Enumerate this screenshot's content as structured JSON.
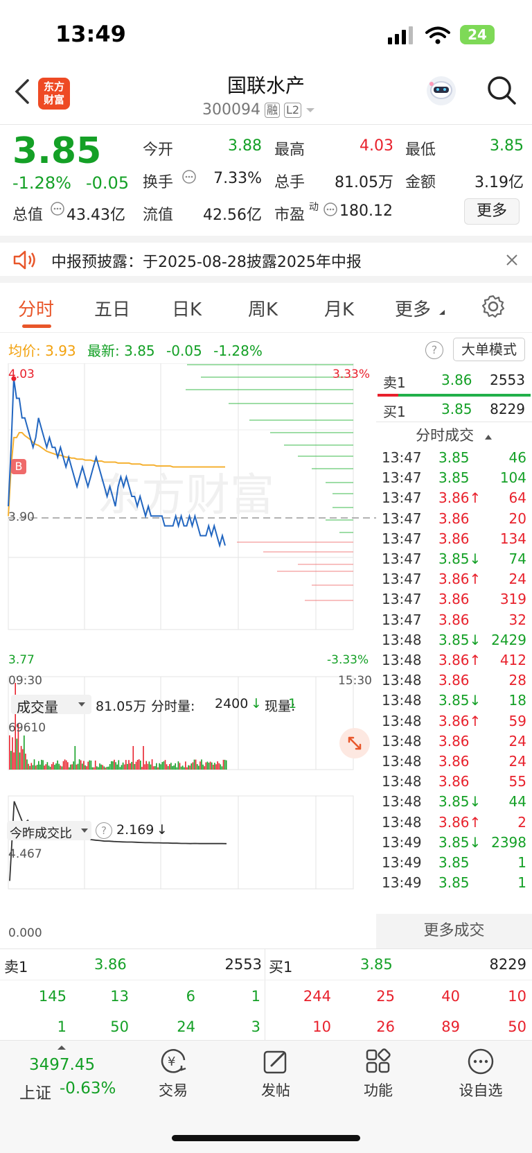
{
  "status": {
    "time": "13:49",
    "battery": "24"
  },
  "header": {
    "logo_text": "东方\n财富",
    "stock_name": "国联水产",
    "stock_code": "300094",
    "tag_rong": "融",
    "tag_l2": "L2"
  },
  "quote": {
    "price": "3.85",
    "pct": "-1.28%",
    "change": "-0.05",
    "open_label": "今开",
    "open": "3.88",
    "high_label": "最高",
    "high": "4.03",
    "low_label": "最低",
    "low": "3.85",
    "turnover_label": "换手",
    "turnover": "7.33%",
    "volume_label": "总手",
    "volume": "81.05万",
    "amount_label": "金额",
    "amount": "3.19亿",
    "mcap_label": "总值",
    "mcap": "43.43亿",
    "float_label": "流值",
    "float": "42.56亿",
    "pe_label": "市盈",
    "pe_sup": "动",
    "pe": "180.12",
    "more": "更多"
  },
  "notice": {
    "text": "中报预披露：于2025-08-28披露2025年中报"
  },
  "tabs": [
    "分时",
    "五日",
    "日K",
    "周K",
    "月K",
    "更多"
  ],
  "info": {
    "avg_label": "均价:",
    "avg": "3.93",
    "latest_label": "最新:",
    "latest": "3.85",
    "chg": "-0.05",
    "pct": "-1.28%",
    "big_order": "大单模式"
  },
  "chart_labels": {
    "top": "4.03",
    "top_pct": "3.33%",
    "mid": "3.90",
    "bottom": "3.77",
    "bottom_pct": "-3.33%",
    "start_time": "09:30",
    "end_time": "15:30",
    "b_marker": "B",
    "watermark": "东方财富"
  },
  "volume_bar": {
    "label": "成交量",
    "total": "81.05万",
    "min_label": "分时量:",
    "min_val": "2400",
    "now_label": "现量:",
    "now_val": "1",
    "max": "69610"
  },
  "ratio_bar": {
    "label": "今昨成交比",
    "value": "2.169",
    "max": "4.467",
    "min": "0.000"
  },
  "orderbook_top": {
    "sell_label": "卖1",
    "sell_price": "3.86",
    "sell_vol": "2553",
    "buy_label": "买1",
    "buy_price": "3.85",
    "buy_vol": "8229"
  },
  "trades_header": "分时成交",
  "trades": [
    {
      "t": "13:47",
      "p": "3.85",
      "v": "46",
      "c": "green"
    },
    {
      "t": "13:47",
      "p": "3.85",
      "v": "104",
      "c": "green"
    },
    {
      "t": "13:47",
      "p": "3.86↑",
      "v": "64",
      "c": "red"
    },
    {
      "t": "13:47",
      "p": "3.86",
      "v": "20",
      "c": "red"
    },
    {
      "t": "13:47",
      "p": "3.86",
      "v": "134",
      "c": "red"
    },
    {
      "t": "13:47",
      "p": "3.85↓",
      "v": "74",
      "c": "green"
    },
    {
      "t": "13:47",
      "p": "3.86↑",
      "v": "24",
      "c": "red"
    },
    {
      "t": "13:47",
      "p": "3.86",
      "v": "319",
      "c": "red"
    },
    {
      "t": "13:47",
      "p": "3.86",
      "v": "32",
      "c": "red"
    },
    {
      "t": "13:48",
      "p": "3.85↓",
      "v": "2429",
      "c": "green"
    },
    {
      "t": "13:48",
      "p": "3.86↑",
      "v": "412",
      "c": "red"
    },
    {
      "t": "13:48",
      "p": "3.86",
      "v": "28",
      "c": "red"
    },
    {
      "t": "13:48",
      "p": "3.85↓",
      "v": "18",
      "c": "green"
    },
    {
      "t": "13:48",
      "p": "3.86↑",
      "v": "59",
      "c": "red"
    },
    {
      "t": "13:48",
      "p": "3.86",
      "v": "24",
      "c": "red"
    },
    {
      "t": "13:48",
      "p": "3.86",
      "v": "24",
      "c": "red"
    },
    {
      "t": "13:48",
      "p": "3.86",
      "v": "55",
      "c": "red"
    },
    {
      "t": "13:48",
      "p": "3.85↓",
      "v": "44",
      "c": "green"
    },
    {
      "t": "13:48",
      "p": "3.86↑",
      "v": "2",
      "c": "red"
    },
    {
      "t": "13:49",
      "p": "3.85↓",
      "v": "2398",
      "c": "green"
    },
    {
      "t": "13:49",
      "p": "3.85",
      "v": "1",
      "c": "green"
    },
    {
      "t": "13:49",
      "p": "3.85",
      "v": "1",
      "c": "green"
    }
  ],
  "more_trades": "更多成交",
  "orderbook_bottom": {
    "sell_label": "卖1",
    "sell_price": "3.86",
    "sell_vol": "2553",
    "buy_label": "买1",
    "buy_price": "3.85",
    "buy_vol": "8229",
    "sell_row1": [
      "145",
      "13",
      "6",
      "1"
    ],
    "sell_row2": [
      "1",
      "50",
      "24",
      "3"
    ],
    "buy_row1": [
      "244",
      "25",
      "40",
      "10"
    ],
    "buy_row2": [
      "10",
      "26",
      "89",
      "50"
    ]
  },
  "nav": {
    "index_value": "3497.45",
    "index_name": "上证",
    "index_pct": "-0.63%",
    "trade": "交易",
    "post": "发帖",
    "func": "功能",
    "watch": "设自选"
  },
  "colors": {
    "up": "#e8212c",
    "down": "#14a026",
    "accent": "#e8562a",
    "avg_line": "#f5b030",
    "price_line": "#2266c0"
  },
  "chart_data": {
    "type": "line",
    "ylim": [
      3.77,
      4.03
    ],
    "prev_close": 3.9,
    "price": [
      3.89,
      3.95,
      4.02,
      4.0,
      4.0,
      3.98,
      3.98,
      3.97,
      3.96,
      3.95,
      3.96,
      3.98,
      3.97,
      3.96,
      3.95,
      3.96,
      3.95,
      3.95,
      3.94,
      3.95,
      3.94,
      3.93,
      3.94,
      3.93,
      3.92,
      3.91,
      3.92,
      3.93,
      3.92,
      3.91,
      3.92,
      3.93,
      3.94,
      3.93,
      3.92,
      3.91,
      3.9,
      3.91,
      3.9,
      3.89,
      3.91,
      3.92,
      3.91,
      3.92,
      3.91,
      3.9,
      3.9,
      3.89,
      3.9,
      3.89,
      3.88,
      3.89,
      3.88,
      3.88,
      3.88,
      3.88,
      3.88,
      3.87,
      3.87,
      3.87,
      3.87,
      3.88,
      3.87,
      3.88,
      3.87,
      3.87,
      3.88,
      3.87,
      3.88,
      3.87,
      3.86,
      3.86,
      3.86,
      3.87,
      3.86,
      3.87,
      3.86,
      3.85,
      3.86,
      3.85
    ],
    "avg": [
      3.88,
      3.93,
      3.96,
      3.96,
      3.965,
      3.965,
      3.962,
      3.96,
      3.958,
      3.955,
      3.953,
      3.952,
      3.95,
      3.948,
      3.946,
      3.945,
      3.944,
      3.943,
      3.942,
      3.942,
      3.941,
      3.94,
      3.94,
      3.939,
      3.939,
      3.938,
      3.938,
      3.938,
      3.937,
      3.937,
      3.937,
      3.936,
      3.936,
      3.936,
      3.936,
      3.935,
      3.935,
      3.935,
      3.935,
      3.935,
      3.934,
      3.934,
      3.934,
      3.934,
      3.934,
      3.933,
      3.933,
      3.933,
      3.933,
      3.932,
      3.932,
      3.932,
      3.932,
      3.932,
      3.931,
      3.931,
      3.931,
      3.931,
      3.931,
      3.931,
      3.93,
      3.93,
      3.93,
      3.93,
      3.93,
      3.93,
      3.93,
      3.93,
      3.93,
      3.93,
      3.93,
      3.93,
      3.93,
      3.93,
      3.93,
      3.93,
      3.93,
      3.93,
      3.93,
      3.93
    ],
    "ratio": [
      0.2,
      4.4,
      3.8,
      3.2,
      3.4,
      3.0,
      3.1,
      2.9,
      2.8,
      2.7,
      2.75,
      2.6,
      2.55,
      2.5,
      2.5,
      2.45,
      2.4,
      2.42,
      2.38,
      2.35,
      2.33,
      2.3,
      2.3,
      2.28,
      2.27,
      2.26,
      2.25,
      2.25,
      2.24,
      2.23,
      2.22,
      2.22,
      2.21,
      2.21,
      2.2,
      2.2,
      2.19,
      2.19,
      2.18,
      2.18,
      2.17,
      2.18,
      2.17,
      2.17,
      2.17,
      2.17,
      2.17,
      2.17,
      2.169
    ]
  }
}
